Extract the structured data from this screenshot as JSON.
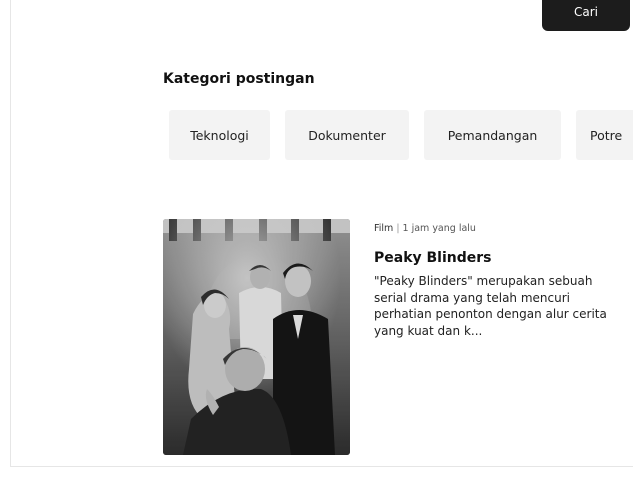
{
  "header": {
    "search_button_label": "Cari"
  },
  "categories": {
    "title": "Kategori postingan",
    "items": [
      {
        "label": "Teknologi"
      },
      {
        "label": "Dokumenter"
      },
      {
        "label": "Pemandangan"
      },
      {
        "label": "Potre"
      }
    ]
  },
  "post": {
    "category": "Film",
    "separator": "|",
    "time": "1 jam yang lalu",
    "title": "Peaky Blinders",
    "excerpt": "\"Peaky Blinders\" merupakan sebuah serial drama yang telah mencuri perhatian penonton dengan alur cerita yang kuat dan k..."
  }
}
